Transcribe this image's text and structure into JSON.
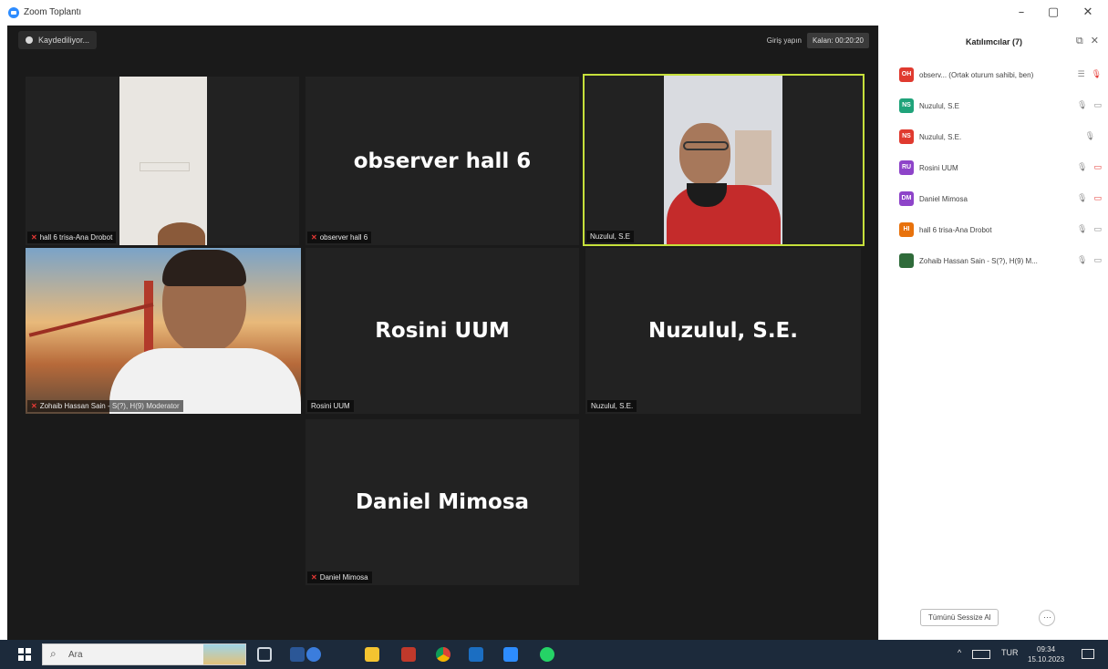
{
  "window": {
    "title": "Zoom Toplantı",
    "minimize_glyph": "–",
    "maximize_glyph": "▢",
    "close_glyph": "✕"
  },
  "meeting": {
    "recording_label": "Kaydediliyor...",
    "top_right_label": "Giriş yapın",
    "leave_label": "Kalan: 00:20:20"
  },
  "tiles": [
    {
      "name": "hall 6 trisa-Ana Drobot",
      "muted": true,
      "video": true,
      "big": ""
    },
    {
      "name": "observer hall 6",
      "muted": true,
      "video": false,
      "big": "observer hall 6"
    },
    {
      "name": "Nuzulul, S.E",
      "muted": false,
      "video": true,
      "big": ""
    },
    {
      "name": "Zohaib Hassan Sain - S(?), H(9) Moderator",
      "muted": true,
      "video": true,
      "big": ""
    },
    {
      "name": "Rosini UUM",
      "muted": false,
      "video": false,
      "big": "Rosini UUM"
    },
    {
      "name": "Nuzulul, S.E.",
      "muted": false,
      "video": false,
      "big": "Nuzulul, S.E."
    },
    {
      "name": "Daniel Mimosa",
      "muted": true,
      "video": false,
      "big": "Daniel Mimosa"
    }
  ],
  "panel": {
    "title": "Katılımcılar (7)",
    "popout_glyph": "⧉",
    "close_glyph": "✕",
    "participants": [
      {
        "initials": "OH",
        "color": "#e03a2f",
        "name": "observ... (Ortak oturum sahibi, ben)",
        "mic": "☰",
        "cam": "🎙",
        "cam_red": true
      },
      {
        "initials": "NS",
        "color": "#1fa37a",
        "name": "Nuzulul, S.E",
        "mic": "🎙",
        "cam": "▭",
        "cam_red": false
      },
      {
        "initials": "NS",
        "color": "#e03a2f",
        "name": "Nuzulul, S.E.",
        "mic": "🎙",
        "cam": "",
        "cam_red": false
      },
      {
        "initials": "RU",
        "color": "#8e44c9",
        "name": "Rosini UUM",
        "mic": "🎙",
        "cam": "▭",
        "cam_red": true
      },
      {
        "initials": "DM",
        "color": "#8e44c9",
        "name": "Daniel Mimosa",
        "mic": "🎙",
        "cam": "▭",
        "cam_red": true
      },
      {
        "initials": "HI",
        "color": "#e8720c",
        "name": "hall 6 trisa-Ana Drobot",
        "mic": "🎙",
        "cam": "▭",
        "cam_red": false
      },
      {
        "initials": "",
        "color": "#2f6b3a",
        "name": "Zohaib Hassan Sain - S(?), H(9) M...",
        "mic": "🎙",
        "cam": "▭",
        "cam_red": false
      }
    ],
    "mute_all_label": "Tümünü Sessize Al",
    "more_label": "···"
  },
  "taskbar": {
    "search_placeholder": "Ara",
    "language": "TUR",
    "time": "09:34",
    "date": "15.10.2023",
    "tray_arrow": "^"
  }
}
